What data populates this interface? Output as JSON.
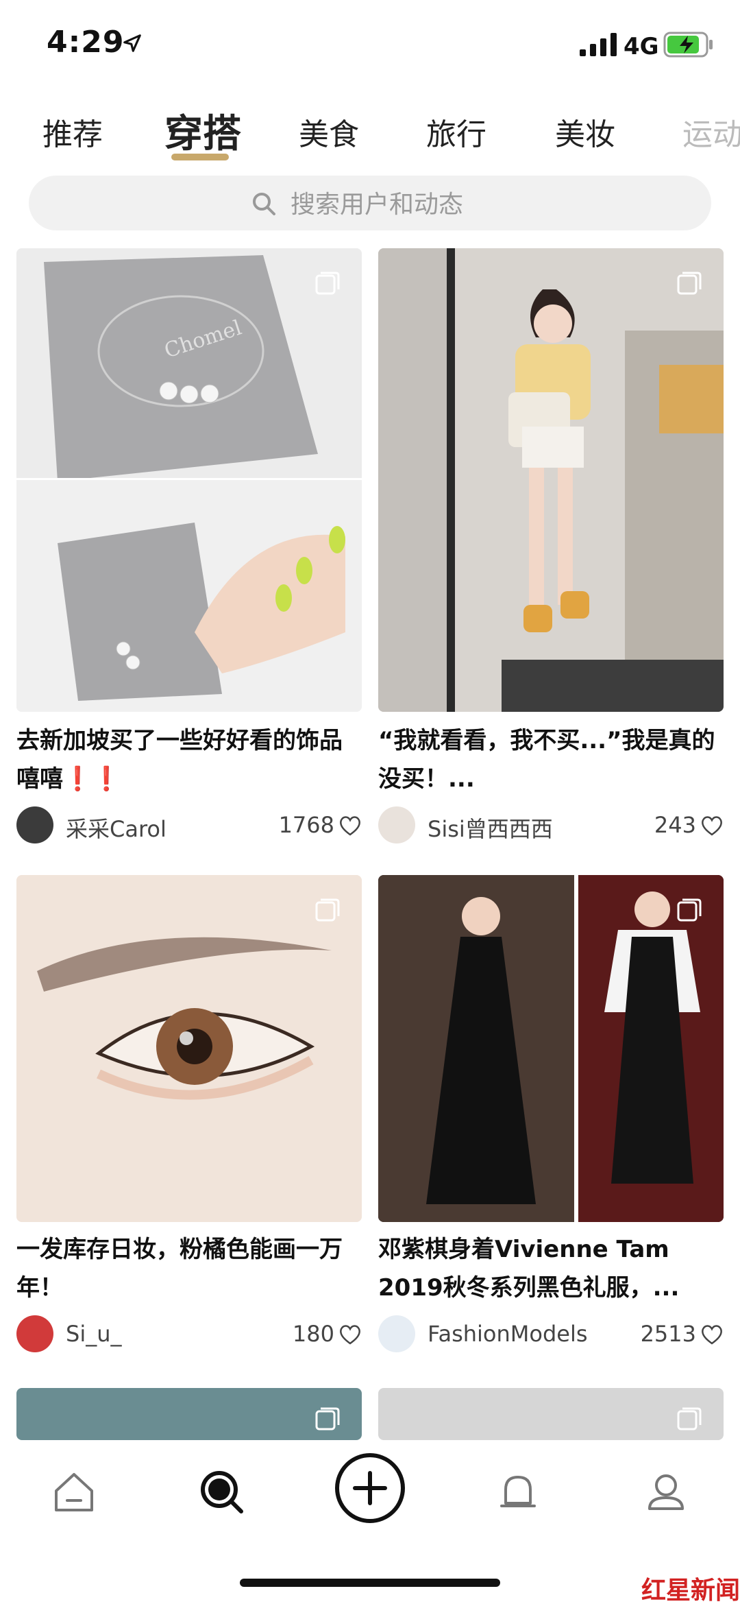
{
  "status": {
    "time": "4:29",
    "network": "4G"
  },
  "tabs": [
    "推荐",
    "穿搭",
    "美食",
    "旅行",
    "美妆",
    "运动"
  ],
  "active_tab": "穿搭",
  "search": {
    "placeholder": "搜索用户和动态"
  },
  "cards": [
    {
      "title": "去新加坡买了一些好好看的饰品嘻嘻❗️❗️",
      "user": "采采Carol",
      "likes": "1768"
    },
    {
      "title": "“我就看看，我不买...”我是真的没买！...",
      "user": "Sisi曾西西西",
      "likes": "243"
    },
    {
      "title": "一发库存日妆，粉橘色能画一万年！",
      "user": "Si_u_",
      "likes": "180"
    },
    {
      "title": "邓紫棋身着Vivienne Tam 2019秋冬系列黑色礼服，...",
      "user": "FashionModels",
      "likes": "2513"
    }
  ],
  "image_text": {
    "brand_pouch": "Chomel"
  },
  "watermark": "红星新闻",
  "colors": {
    "accent": "#c8a86b",
    "search_bg": "#f1f1f1"
  }
}
